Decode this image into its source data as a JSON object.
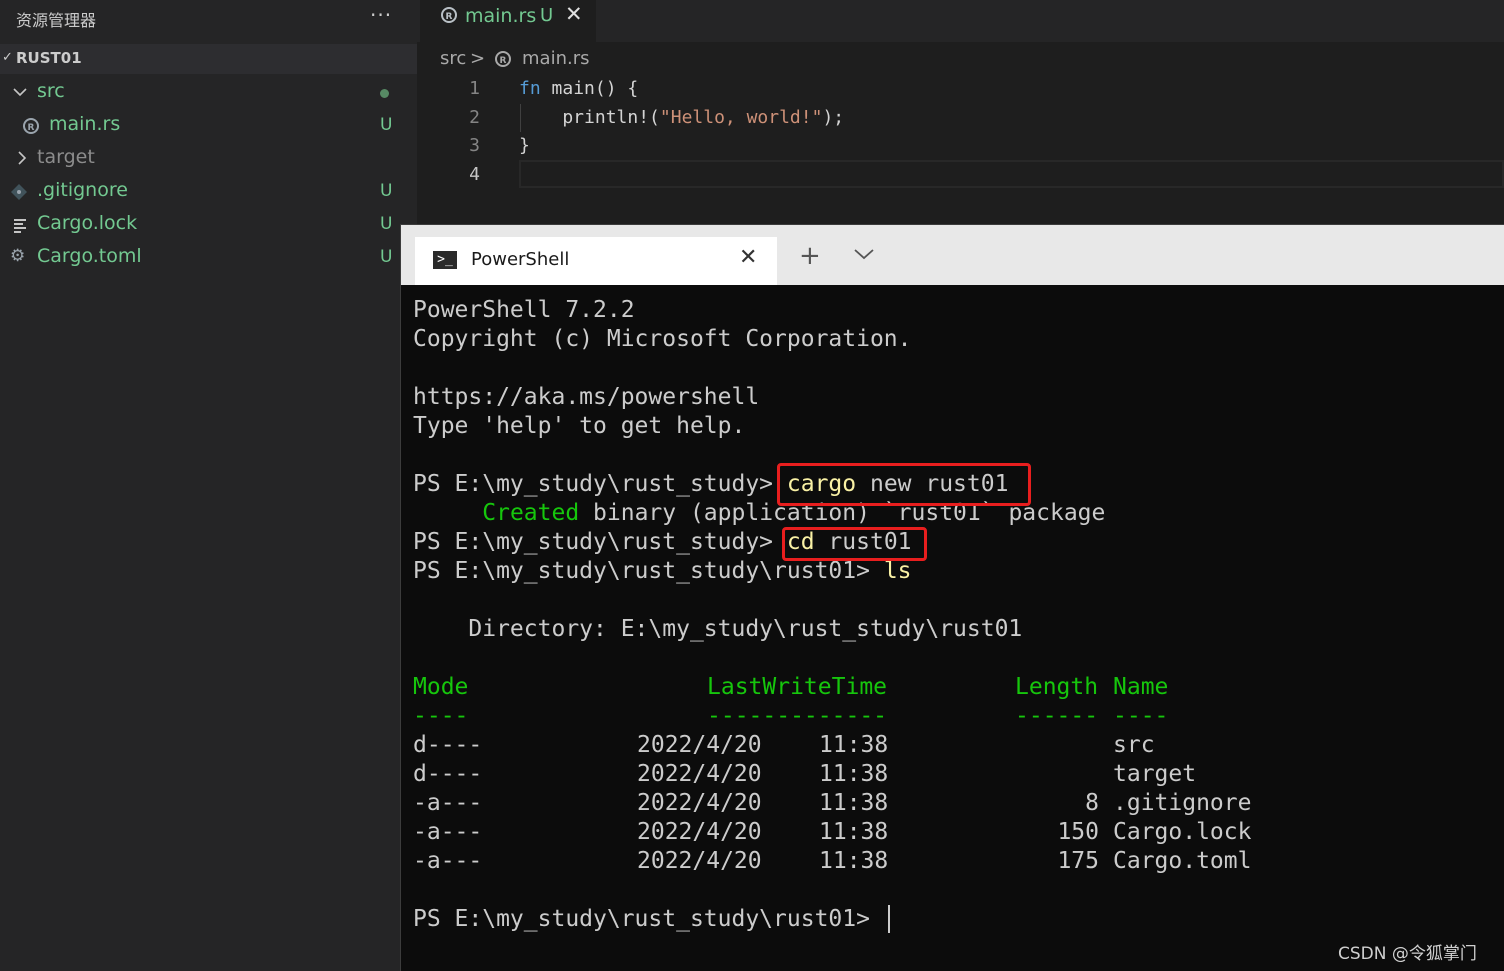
{
  "sidebar": {
    "title": "资源管理器",
    "more": "···",
    "section_title": "RUST01",
    "items": [
      {
        "label": "src",
        "status": ""
      },
      {
        "label": "main.rs",
        "status": "U"
      },
      {
        "label": "target",
        "status": ""
      },
      {
        "label": ".gitignore",
        "status": "U"
      },
      {
        "label": "Cargo.lock",
        "status": "U"
      },
      {
        "label": "Cargo.toml",
        "status": "U"
      }
    ]
  },
  "editor": {
    "tab": {
      "label": "main.rs",
      "status": "U",
      "close": "✕"
    },
    "breadcrumb": {
      "folder": "src",
      "separator": ">",
      "file": "main.rs"
    },
    "line_numbers": [
      "1",
      "2",
      "3",
      "4"
    ],
    "code": {
      "line1_kw": "fn",
      "line1_rest": " main() {",
      "line2_fn": "    println!(",
      "line2_str": "\"Hello, world!\"",
      "line2_end": ");",
      "line3": "}"
    }
  },
  "terminal": {
    "tab_label": "PowerShell",
    "tab_close": "✕",
    "new_tab": "+",
    "dropdown": "⌵",
    "lines": {
      "version": "PowerShell 7.2.2",
      "copyright": "Copyright (c) Microsoft Corporation.",
      "url": "https://aka.ms/powershell",
      "help": "Type 'help' to get help.",
      "prompt1": "PS E:\\my_study\\rust_study> ",
      "cmd1_name": "cargo",
      "cmd1_args": " new rust01",
      "created_word": "Created",
      "created_rest": " binary (application) `rust01` package",
      "prompt2": "PS E:\\my_study\\rust_study> ",
      "cmd2_name": "cd",
      "cmd2_args": " rust01",
      "prompt3": "PS E:\\my_study\\rust_study\\rust01> ",
      "cmd3": "ls",
      "directory": "    Directory: E:\\my_study\\rust_study\\rust01",
      "prompt4": "PS E:\\my_study\\rust_study\\rust01> "
    },
    "table": {
      "headers": {
        "mode": "Mode",
        "time": "LastWriteTime",
        "length": "Length",
        "name": "Name"
      },
      "underlines": {
        "mode": "----",
        "time": "-------------",
        "length": "------",
        "name": "----"
      },
      "rows": [
        {
          "mode": "d----",
          "date": "2022/4/20",
          "time": "11:38",
          "length": "",
          "name": "src"
        },
        {
          "mode": "d----",
          "date": "2022/4/20",
          "time": "11:38",
          "length": "",
          "name": "target"
        },
        {
          "mode": "-a---",
          "date": "2022/4/20",
          "time": "11:38",
          "length": "8",
          "name": ".gitignore"
        },
        {
          "mode": "-a---",
          "date": "2022/4/20",
          "time": "11:38",
          "length": "150",
          "name": "Cargo.lock"
        },
        {
          "mode": "-a---",
          "date": "2022/4/20",
          "time": "11:38",
          "length": "175",
          "name": "Cargo.toml"
        }
      ]
    }
  },
  "watermark": "CSDN @令狐掌门",
  "colors": {
    "git_untracked": "#73c991",
    "term_green": "#16c60c",
    "term_yellow": "#f9f1a5",
    "highlight_red": "#e81e1e"
  }
}
